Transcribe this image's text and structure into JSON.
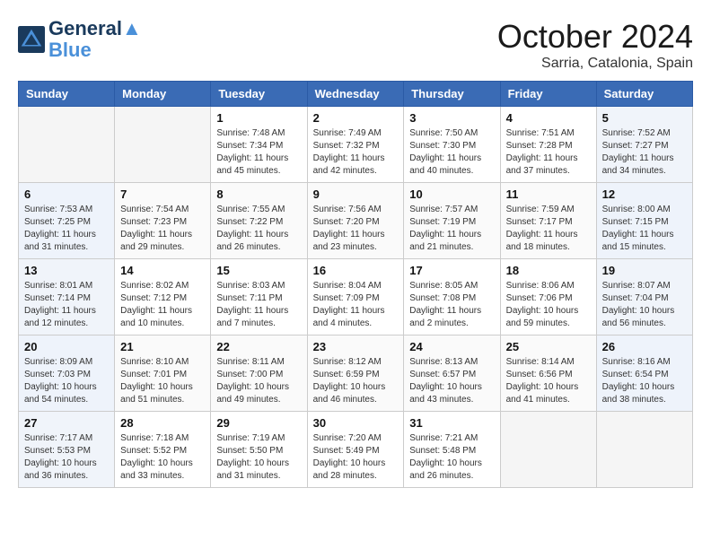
{
  "header": {
    "logo_line1": "General",
    "logo_line2": "Blue",
    "month": "October 2024",
    "location": "Sarria, Catalonia, Spain"
  },
  "weekdays": [
    "Sunday",
    "Monday",
    "Tuesday",
    "Wednesday",
    "Thursday",
    "Friday",
    "Saturday"
  ],
  "weeks": [
    [
      {
        "day": "",
        "info": ""
      },
      {
        "day": "",
        "info": ""
      },
      {
        "day": "1",
        "info": "Sunrise: 7:48 AM\nSunset: 7:34 PM\nDaylight: 11 hours and 45 minutes."
      },
      {
        "day": "2",
        "info": "Sunrise: 7:49 AM\nSunset: 7:32 PM\nDaylight: 11 hours and 42 minutes."
      },
      {
        "day": "3",
        "info": "Sunrise: 7:50 AM\nSunset: 7:30 PM\nDaylight: 11 hours and 40 minutes."
      },
      {
        "day": "4",
        "info": "Sunrise: 7:51 AM\nSunset: 7:28 PM\nDaylight: 11 hours and 37 minutes."
      },
      {
        "day": "5",
        "info": "Sunrise: 7:52 AM\nSunset: 7:27 PM\nDaylight: 11 hours and 34 minutes."
      }
    ],
    [
      {
        "day": "6",
        "info": "Sunrise: 7:53 AM\nSunset: 7:25 PM\nDaylight: 11 hours and 31 minutes."
      },
      {
        "day": "7",
        "info": "Sunrise: 7:54 AM\nSunset: 7:23 PM\nDaylight: 11 hours and 29 minutes."
      },
      {
        "day": "8",
        "info": "Sunrise: 7:55 AM\nSunset: 7:22 PM\nDaylight: 11 hours and 26 minutes."
      },
      {
        "day": "9",
        "info": "Sunrise: 7:56 AM\nSunset: 7:20 PM\nDaylight: 11 hours and 23 minutes."
      },
      {
        "day": "10",
        "info": "Sunrise: 7:57 AM\nSunset: 7:19 PM\nDaylight: 11 hours and 21 minutes."
      },
      {
        "day": "11",
        "info": "Sunrise: 7:59 AM\nSunset: 7:17 PM\nDaylight: 11 hours and 18 minutes."
      },
      {
        "day": "12",
        "info": "Sunrise: 8:00 AM\nSunset: 7:15 PM\nDaylight: 11 hours and 15 minutes."
      }
    ],
    [
      {
        "day": "13",
        "info": "Sunrise: 8:01 AM\nSunset: 7:14 PM\nDaylight: 11 hours and 12 minutes."
      },
      {
        "day": "14",
        "info": "Sunrise: 8:02 AM\nSunset: 7:12 PM\nDaylight: 11 hours and 10 minutes."
      },
      {
        "day": "15",
        "info": "Sunrise: 8:03 AM\nSunset: 7:11 PM\nDaylight: 11 hours and 7 minutes."
      },
      {
        "day": "16",
        "info": "Sunrise: 8:04 AM\nSunset: 7:09 PM\nDaylight: 11 hours and 4 minutes."
      },
      {
        "day": "17",
        "info": "Sunrise: 8:05 AM\nSunset: 7:08 PM\nDaylight: 11 hours and 2 minutes."
      },
      {
        "day": "18",
        "info": "Sunrise: 8:06 AM\nSunset: 7:06 PM\nDaylight: 10 hours and 59 minutes."
      },
      {
        "day": "19",
        "info": "Sunrise: 8:07 AM\nSunset: 7:04 PM\nDaylight: 10 hours and 56 minutes."
      }
    ],
    [
      {
        "day": "20",
        "info": "Sunrise: 8:09 AM\nSunset: 7:03 PM\nDaylight: 10 hours and 54 minutes."
      },
      {
        "day": "21",
        "info": "Sunrise: 8:10 AM\nSunset: 7:01 PM\nDaylight: 10 hours and 51 minutes."
      },
      {
        "day": "22",
        "info": "Sunrise: 8:11 AM\nSunset: 7:00 PM\nDaylight: 10 hours and 49 minutes."
      },
      {
        "day": "23",
        "info": "Sunrise: 8:12 AM\nSunset: 6:59 PM\nDaylight: 10 hours and 46 minutes."
      },
      {
        "day": "24",
        "info": "Sunrise: 8:13 AM\nSunset: 6:57 PM\nDaylight: 10 hours and 43 minutes."
      },
      {
        "day": "25",
        "info": "Sunrise: 8:14 AM\nSunset: 6:56 PM\nDaylight: 10 hours and 41 minutes."
      },
      {
        "day": "26",
        "info": "Sunrise: 8:16 AM\nSunset: 6:54 PM\nDaylight: 10 hours and 38 minutes."
      }
    ],
    [
      {
        "day": "27",
        "info": "Sunrise: 7:17 AM\nSunset: 5:53 PM\nDaylight: 10 hours and 36 minutes."
      },
      {
        "day": "28",
        "info": "Sunrise: 7:18 AM\nSunset: 5:52 PM\nDaylight: 10 hours and 33 minutes."
      },
      {
        "day": "29",
        "info": "Sunrise: 7:19 AM\nSunset: 5:50 PM\nDaylight: 10 hours and 31 minutes."
      },
      {
        "day": "30",
        "info": "Sunrise: 7:20 AM\nSunset: 5:49 PM\nDaylight: 10 hours and 28 minutes."
      },
      {
        "day": "31",
        "info": "Sunrise: 7:21 AM\nSunset: 5:48 PM\nDaylight: 10 hours and 26 minutes."
      },
      {
        "day": "",
        "info": ""
      },
      {
        "day": "",
        "info": ""
      }
    ]
  ]
}
